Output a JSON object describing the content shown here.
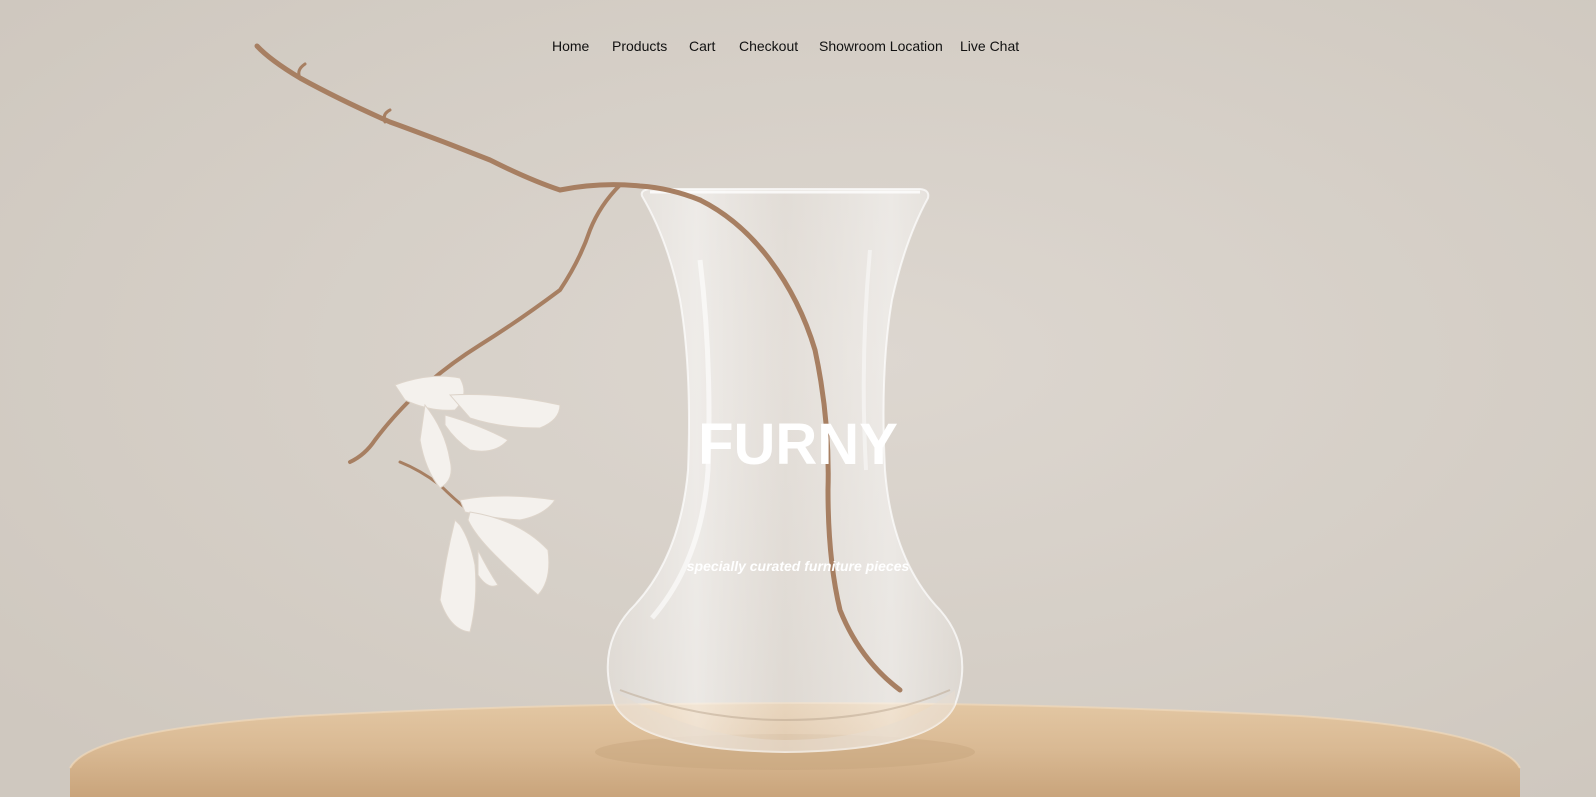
{
  "nav": {
    "items": [
      {
        "label": "Home"
      },
      {
        "label": "Products"
      },
      {
        "label": "Cart"
      },
      {
        "label": "Checkout"
      },
      {
        "label": "Showroom Location"
      },
      {
        "label": "Live Chat"
      }
    ]
  },
  "hero": {
    "title": "FURNY",
    "tagline": "specially curated furniture pieces"
  },
  "colors": {
    "background": "#d6d0c8",
    "text_on_image": "#ffffff",
    "nav_text": "#111111",
    "table_wood": "#d9b993"
  }
}
